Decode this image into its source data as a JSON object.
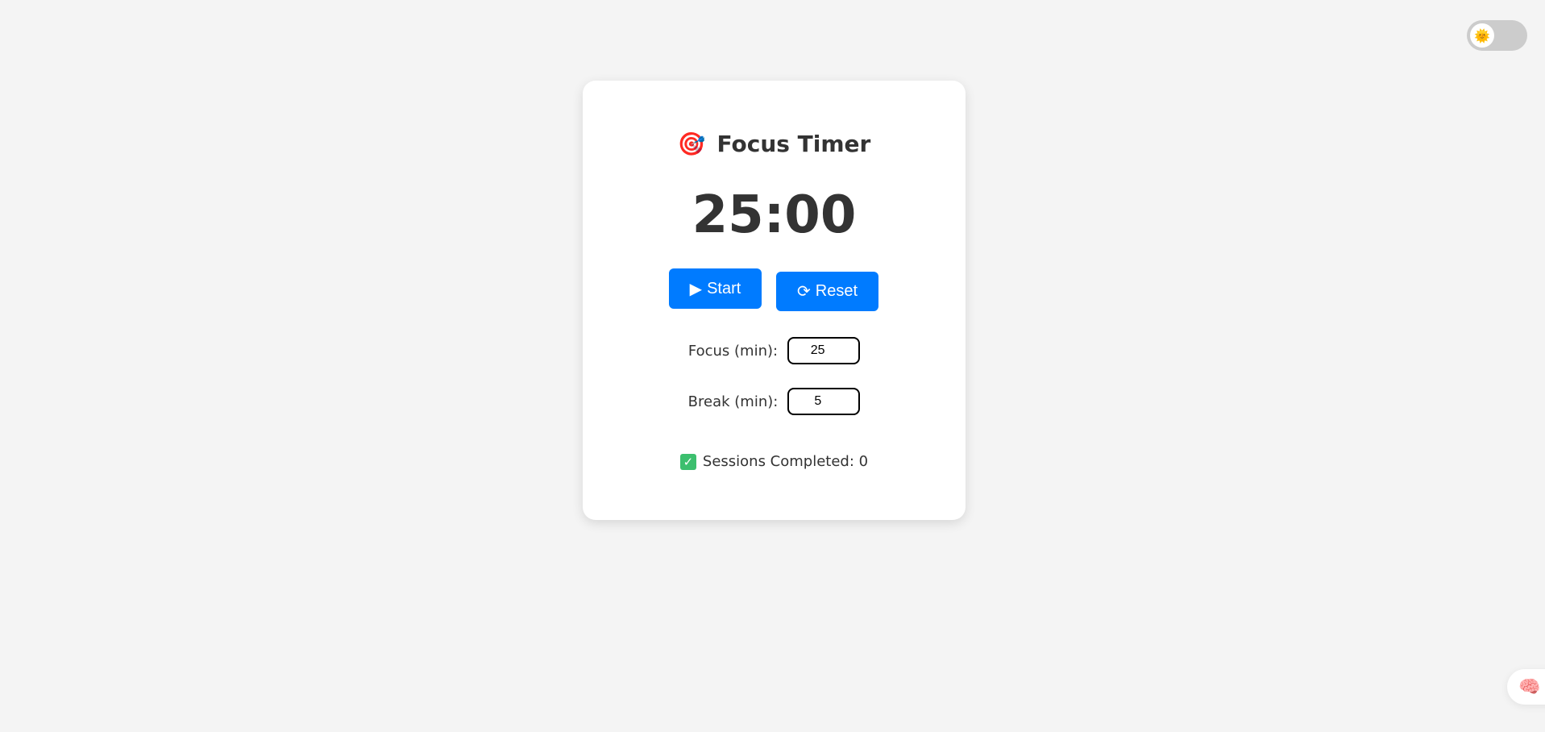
{
  "theme_toggle": {
    "icon": "sun-smile-emoji",
    "glyph": "🌞",
    "state": "off"
  },
  "card": {
    "title_icon": "🎯",
    "title": "Focus Timer",
    "timer": "25:00",
    "start_label": "Start",
    "start_icon": "▶",
    "reset_label": "Reset",
    "reset_icon": "⟳",
    "focus_label": "Focus (min):",
    "focus_value": "25",
    "break_label": "Break (min):",
    "break_value": "5",
    "sessions_icon": "✓",
    "sessions_text": "Sessions Completed: 0"
  },
  "assistant_button": {
    "icon": "brain-emoji",
    "glyph": "🧠"
  },
  "colors": {
    "accent": "#007bff",
    "background": "#f4f4f4",
    "card": "#ffffff",
    "toggle_track": "#cccccc"
  }
}
